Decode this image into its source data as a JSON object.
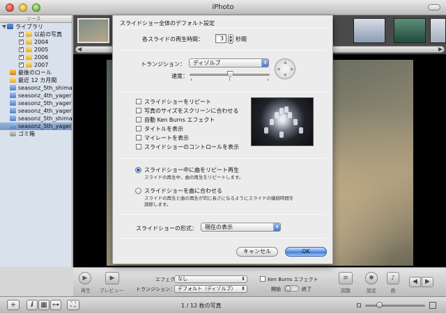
{
  "window": {
    "title": "iPhoto"
  },
  "sidebar": {
    "header": "ソース",
    "items": [
      {
        "label": "ライブラリ"
      },
      {
        "label": "以前の写真"
      },
      {
        "label": "2004"
      },
      {
        "label": "2005"
      },
      {
        "label": "2006"
      },
      {
        "label": "2007"
      },
      {
        "label": "最後のロール"
      },
      {
        "label": "最近 12 カ月間"
      },
      {
        "label": "seasonz_5th_shima"
      },
      {
        "label": "seasonz_4th_yager"
      },
      {
        "label": "seasonz_5th_yager"
      },
      {
        "label": "seasonz_4th_yager…"
      },
      {
        "label": "seasonz_5th_shima…"
      },
      {
        "label": "seasonz_5th_yager…"
      },
      {
        "label": "ゴミ箱"
      }
    ]
  },
  "status_bar": {
    "add_label": "+",
    "info_label": "i",
    "photo_count": "1 / 12 枚の写真"
  },
  "toolbar": {
    "play_label": "再生",
    "preview_label": "プレビュー",
    "effect_label": "エフェクト：",
    "effect_value": "なし",
    "transition_label": "トランジション：",
    "transition_value": "デフォルト（ディゾルブ）",
    "kenburns_label": "Ken Burns エフェクト",
    "start_label": "開始",
    "end_label": "終了",
    "adjust_label": "調整",
    "settings_label": "設定",
    "music_label": "曲"
  },
  "dialog": {
    "title": "スライドショー全体のデフォルト設定",
    "duration_label": "各スライドの再生時間：",
    "duration_value": "3",
    "duration_unit": "秒間",
    "transition_label": "トランジション：",
    "transition_value": "ディゾルブ",
    "speed_label": "速度：",
    "speed_level": 0.5,
    "checkboxes": [
      {
        "label": "スライドショーをリピート"
      },
      {
        "label": "写真のサイズをスクリーンに合わせる"
      },
      {
        "label": "自動 Ken Burns エフェクト"
      },
      {
        "label": "タイトルを表示"
      },
      {
        "label": "マイレートを表示"
      },
      {
        "label": "スライドショーのコントロールを表示"
      }
    ],
    "radio_repeat_music": {
      "label": "スライドショー中に曲をリピート再生",
      "desc": "スライドの再生中、曲の再生をリピートします。",
      "selected": true
    },
    "radio_fit_music": {
      "label": "スライドショーを曲に合わせる",
      "desc_line1": "スライドの再生と曲の再生が同じ長さになるようにスライドの継続時間を",
      "desc_line2": "調節します。",
      "selected": false
    },
    "format_label": "スライドショーの形式：",
    "format_value": "現在の表示",
    "cancel_label": "キャンセル",
    "ok_label": "OK"
  }
}
